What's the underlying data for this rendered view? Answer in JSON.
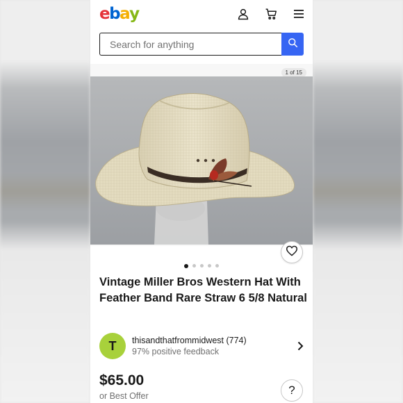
{
  "header": {
    "logo_letters": [
      "e",
      "b",
      "a",
      "y"
    ],
    "icons": [
      "account-icon",
      "cart-icon",
      "menu-icon"
    ]
  },
  "search": {
    "placeholder": "Search for anything"
  },
  "gallery": {
    "counter": "1 of 15",
    "image_count": 15,
    "current_image": 1,
    "dots_visible": 5
  },
  "listing": {
    "title": "Vintage Miller Bros Western Hat With Feather Band Rare Straw 6 5/8 Natural",
    "price": "$65.00",
    "best_offer": "or Best Offer"
  },
  "seller": {
    "avatar_letter": "T",
    "name": "thisandthatfrommidwest (774)",
    "feedback": "97% positive feedback"
  },
  "help_label": "?",
  "colors": {
    "logo_e": "#e53238",
    "logo_b": "#0064d2",
    "logo_a": "#f5af02",
    "logo_y": "#86b817",
    "search_button": "#3665f3",
    "avatar_bg": "#a8d13b"
  }
}
